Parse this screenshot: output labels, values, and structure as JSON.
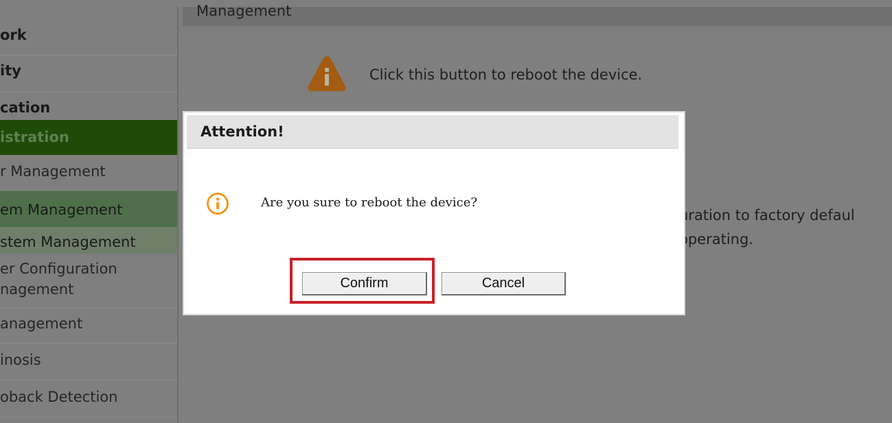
{
  "sidebar": {
    "items": [
      {
        "label": "ork"
      },
      {
        "label": "ity"
      },
      {
        "label": "cation"
      },
      {
        "label": "istration"
      },
      {
        "label": "r Management"
      },
      {
        "label": "em Management"
      },
      {
        "label": "stem Management"
      },
      {
        "label": "er Configuration"
      },
      {
        "label": "nagement"
      },
      {
        "label": "anagement"
      },
      {
        "label": "inosis"
      },
      {
        "label": "oback Detection"
      }
    ]
  },
  "header": {
    "title": "Management"
  },
  "background": {
    "reboot_hint": "Click this button to reboot the device.",
    "restore_line1": "uration to factory defaul",
    "restore_line2": "operating."
  },
  "dialog": {
    "title": "Attention!",
    "message": "Are you sure to reboot the device?",
    "confirm_label": "Confirm",
    "cancel_label": "Cancel"
  },
  "colors": {
    "overlay_gray": "#7f7f7f",
    "nav_active": "#1f4a08",
    "highlight_red": "#c8202a",
    "info_orange": "#f39a1e"
  },
  "icons": {
    "background_warning": "warning-triangle-icon",
    "dialog_info": "info-circle-icon"
  }
}
